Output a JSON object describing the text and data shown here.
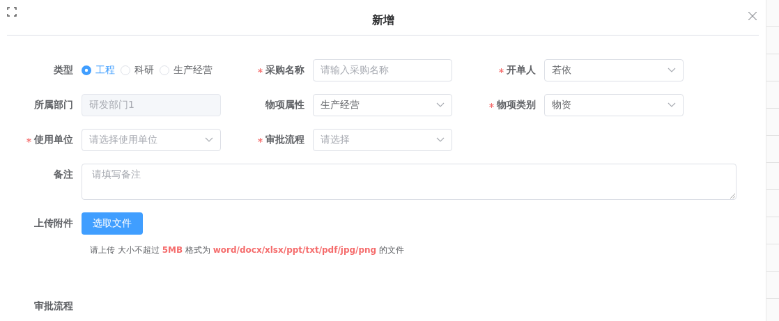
{
  "dialog": {
    "title": "新增"
  },
  "fields": [
    {
      "kind": "radio",
      "label": "类型",
      "required": false,
      "options": [
        {
          "label": "工程",
          "selected": true
        },
        {
          "label": "科研",
          "selected": false
        },
        {
          "label": "生产经营",
          "selected": false
        }
      ]
    },
    {
      "kind": "input",
      "label": "采购名称",
      "required": true,
      "placeholder": "请输入采购名称"
    },
    {
      "kind": "select",
      "label": "开单人",
      "required": true,
      "value": "若依"
    },
    {
      "kind": "input",
      "label": "所属部门",
      "required": false,
      "value": "研发部门1",
      "disabled": true
    },
    {
      "kind": "select",
      "label": "物项属性",
      "required": false,
      "value": "生产经营"
    },
    {
      "kind": "select",
      "label": "物项类别",
      "required": true,
      "value": "物资"
    },
    {
      "kind": "select",
      "label": "使用单位",
      "required": true,
      "placeholder": "请选择使用单位"
    },
    {
      "kind": "select",
      "label": "审批流程",
      "required": true,
      "placeholder": "请选择"
    }
  ],
  "remarks": {
    "label": "备注",
    "placeholder": "请填写备注"
  },
  "upload": {
    "label": "上传附件",
    "button": "选取文件",
    "hint": "请上传 大小不超过 **5MB** 格式为 **word/docx/xlsx/ppt/txt/pdf/jpg/png** 的文件"
  },
  "approval": {
    "label": "审批流程"
  }
}
